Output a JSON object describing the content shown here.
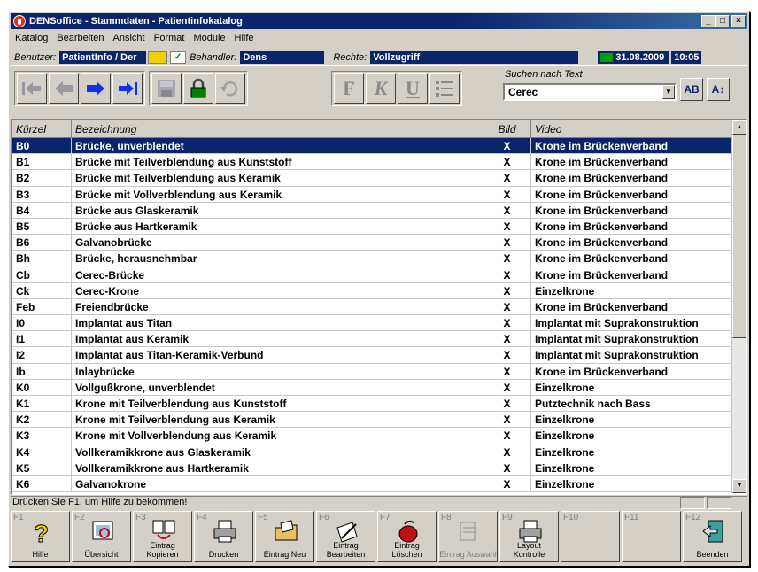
{
  "window": {
    "title": "DENSoffice - Stammdaten - Patientinfokatalog"
  },
  "menu": [
    "Katalog",
    "Bearbeiten",
    "Ansicht",
    "Format",
    "Module",
    "Hilfe"
  ],
  "info": {
    "benutzer_label": "Benutzer:",
    "benutzer": "PatientInfo / Der",
    "behandler_label": "Behandler:",
    "behandler": "Dens",
    "rechte_label": "Rechte:",
    "rechte": "Vollzugriff",
    "date": "31.08.2009",
    "time": "10:05"
  },
  "search": {
    "label": "Suchen nach Text",
    "value": "Cerec"
  },
  "grid": {
    "headers": [
      "Kürzel",
      "Bezeichnung",
      "Bild",
      "Video"
    ],
    "rows": [
      [
        "B0",
        "Brücke, unverblendet",
        "X",
        "Krone im Brückenverband"
      ],
      [
        "B1",
        "Brücke mit Teilverblendung aus Kunststoff",
        "X",
        "Krone im Brückenverband"
      ],
      [
        "B2",
        "Brücke mit Teilverblendung aus Keramik",
        "X",
        "Krone im Brückenverband"
      ],
      [
        "B3",
        "Brücke mit Vollverblendung aus Keramik",
        "X",
        "Krone im Brückenverband"
      ],
      [
        "B4",
        "Brücke aus Glaskeramik",
        "X",
        "Krone im Brückenverband"
      ],
      [
        "B5",
        "Brücke aus Hartkeramik",
        "X",
        "Krone im Brückenverband"
      ],
      [
        "B6",
        "Galvanobrücke",
        "X",
        "Krone im Brückenverband"
      ],
      [
        "Bh",
        "Brücke, herausnehmbar",
        "X",
        "Krone im Brückenverband"
      ],
      [
        "Cb",
        "Cerec-Brücke",
        "X",
        "Krone im Brückenverband"
      ],
      [
        "Ck",
        "Cerec-Krone",
        "X",
        "Einzelkrone"
      ],
      [
        "Feb",
        "Freiendbrücke",
        "X",
        "Krone im Brückenverband"
      ],
      [
        "I0",
        "Implantat aus Titan",
        "X",
        "Implantat mit Suprakonstruktion"
      ],
      [
        "I1",
        "Implantat aus Keramik",
        "X",
        "Implantat mit Suprakonstruktion"
      ],
      [
        "I2",
        "Implantat aus Titan-Keramik-Verbund",
        "X",
        "Implantat mit Suprakonstruktion"
      ],
      [
        "Ib",
        "Inlaybrücke",
        "X",
        "Krone im Brückenverband"
      ],
      [
        "K0",
        "Vollgußkrone, unverblendet",
        "X",
        "Einzelkrone"
      ],
      [
        "K1",
        "Krone mit Teilverblendung aus Kunststoff",
        "X",
        "Putztechnik nach Bass"
      ],
      [
        "K2",
        "Krone mit Teilverblendung aus Keramik",
        "X",
        "Einzelkrone"
      ],
      [
        "K3",
        "Krone mit Vollverblendung aus Keramik",
        "X",
        "Einzelkrone"
      ],
      [
        "K4",
        "Vollkeramikkrone aus Glaskeramik",
        "X",
        "Einzelkrone"
      ],
      [
        "K5",
        "Vollkeramikkrone aus Hartkeramik",
        "X",
        "Einzelkrone"
      ],
      [
        "K6",
        "Galvanokrone",
        "X",
        "Einzelkrone"
      ]
    ]
  },
  "status": "Drücken Sie F1, um Hilfe zu bekommen!",
  "fkeys": [
    {
      "key": "F1",
      "label": "Hilfe",
      "icon": "help-icon"
    },
    {
      "key": "F2",
      "label": "Übersicht",
      "icon": "overview-icon"
    },
    {
      "key": "F3",
      "label": "Eintrag Kopieren",
      "icon": "copy-icon"
    },
    {
      "key": "F4",
      "label": "Drucken",
      "icon": "printer-icon"
    },
    {
      "key": "F5",
      "label": "Eintrag Neu",
      "icon": "new-icon"
    },
    {
      "key": "F6",
      "label": "Eintrag Bearbeiten",
      "icon": "edit-icon"
    },
    {
      "key": "F7",
      "label": "Eintrag Löschen",
      "icon": "delete-icon"
    },
    {
      "key": "F8",
      "label": "Eintrag Auswahl",
      "icon": "select-icon"
    },
    {
      "key": "F9",
      "label": "Layout Kontrolle",
      "icon": "layout-icon"
    },
    {
      "key": "F10",
      "label": "",
      "icon": ""
    },
    {
      "key": "F11",
      "label": "",
      "icon": ""
    },
    {
      "key": "F12",
      "label": "Beenden",
      "icon": "exit-icon"
    }
  ]
}
